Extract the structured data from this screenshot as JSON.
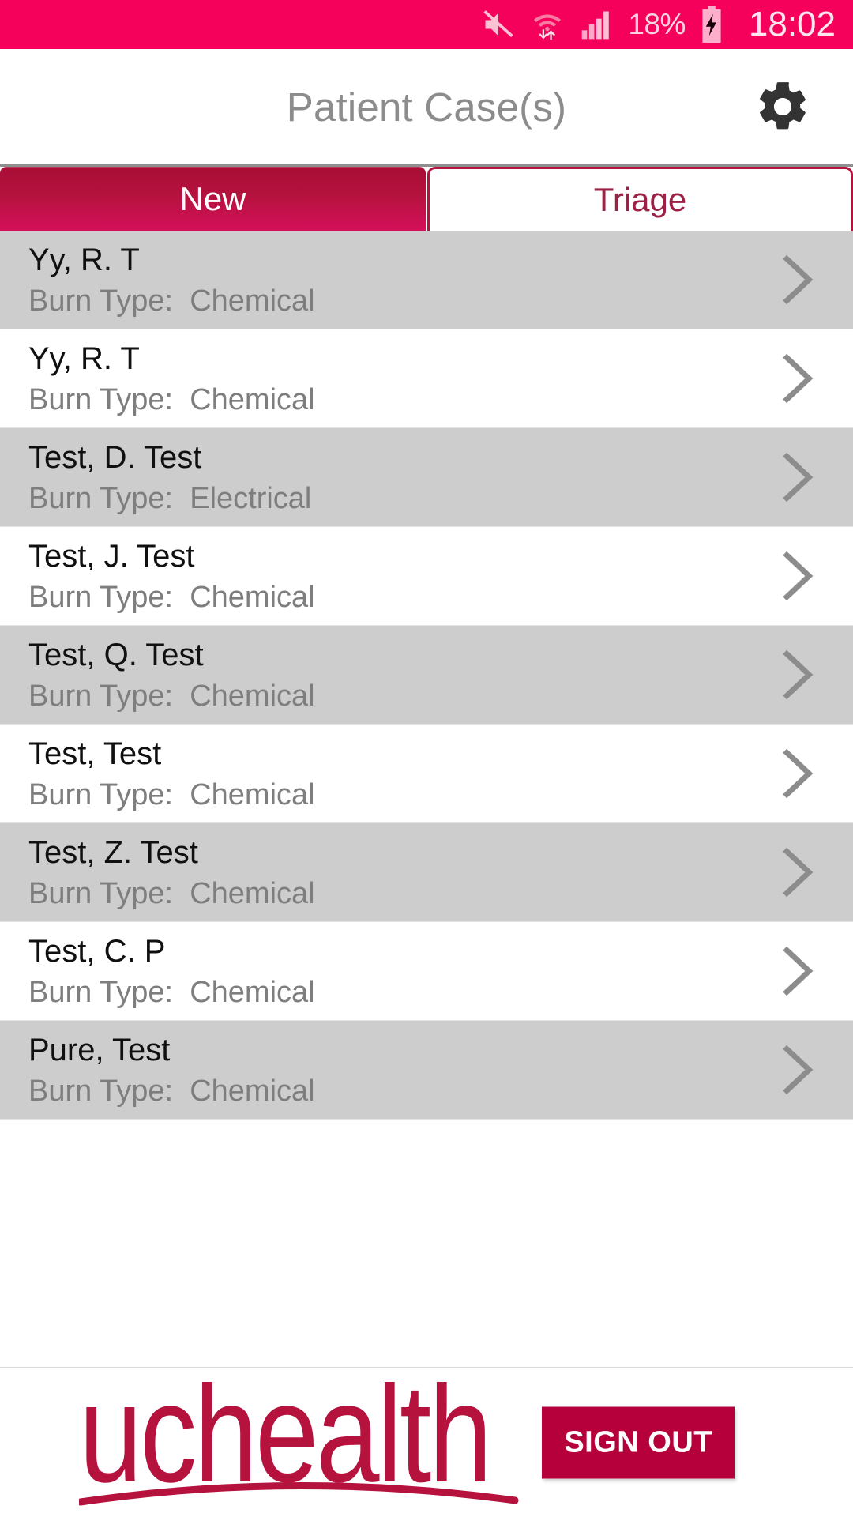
{
  "statusbar": {
    "mute_icon": "mute-speaker-icon",
    "wifi_icon": "wifi-data-transfer-icon",
    "signal_icon": "cellular-signal-icon",
    "battery_percent": "18%",
    "battery_icon": "battery-charging-icon",
    "time": "18:02",
    "background_color": "#f5005a"
  },
  "header": {
    "title": "Patient Case(s)",
    "settings_icon": "gear-icon"
  },
  "tabs": {
    "active_index": 0,
    "items": [
      {
        "label": "New"
      },
      {
        "label": "Triage"
      }
    ],
    "active_color": "#b5123e",
    "inactive_text_color": "#9d2145"
  },
  "list": {
    "burn_type_label": "Burn Type:",
    "chevron_icon": "chevron-right-icon",
    "rows": [
      {
        "name": "Yy, R. T",
        "burn_type": "Chemical"
      },
      {
        "name": "Yy, R. T",
        "burn_type": "Chemical"
      },
      {
        "name": "Test, D. Test",
        "burn_type": "Electrical"
      },
      {
        "name": "Test, J. Test",
        "burn_type": "Chemical"
      },
      {
        "name": "Test, Q. Test",
        "burn_type": "Chemical"
      },
      {
        "name": "Test, Test",
        "burn_type": "Chemical"
      },
      {
        "name": "Test, Z. Test",
        "burn_type": "Chemical"
      },
      {
        "name": "Test, C. P",
        "burn_type": "Chemical"
      },
      {
        "name": "Pure, Test",
        "burn_type": "Chemical"
      }
    ]
  },
  "footer": {
    "logo_text": "uchealth",
    "logo_color": "#b5123e",
    "signout_label": "SIGN OUT",
    "signout_color": "#b5003c"
  }
}
